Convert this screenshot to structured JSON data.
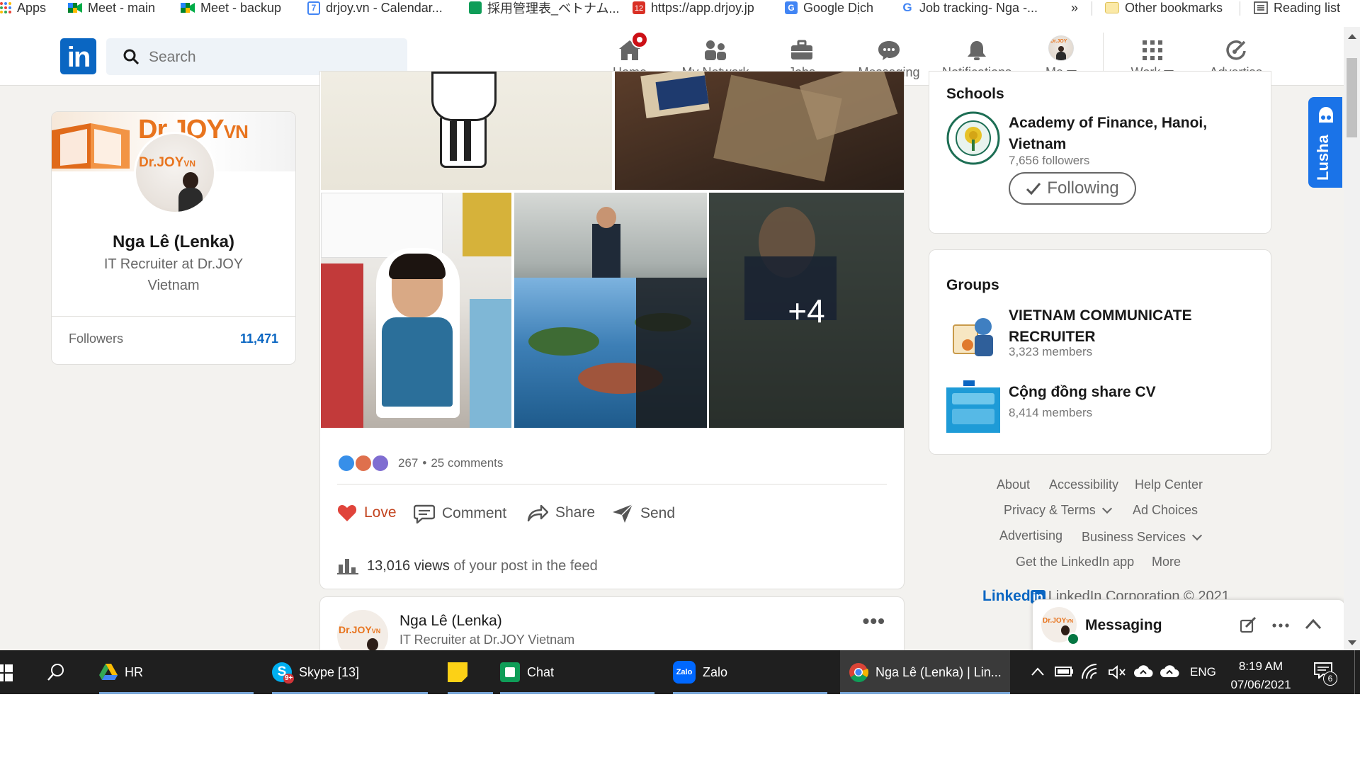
{
  "bookmarks": [
    {
      "label": "Apps",
      "icon": "apps-grid-icon"
    },
    {
      "label": "Meet - main",
      "icon": "google-meet-icon"
    },
    {
      "label": "Meet - backup",
      "icon": "google-meet-icon"
    },
    {
      "label": "drjoy.vn - Calendar...",
      "icon": "calendar-icon"
    },
    {
      "label": "採用管理表_ベトナム...",
      "icon": "sheets-icon"
    },
    {
      "label": "https://app.drjoy.jp",
      "icon": "calendar-12-icon"
    },
    {
      "label": "Google Dịch",
      "icon": "google-translate-icon"
    },
    {
      "label": "Job tracking- Nga -...",
      "icon": "google-icon"
    },
    {
      "label": "»",
      "icon": "more-icon"
    },
    {
      "label": "Other bookmarks",
      "icon": "folder-icon"
    },
    {
      "label": "Reading list",
      "icon": "reading-list-icon"
    }
  ],
  "nav": {
    "search_placeholder": "Search",
    "items": [
      {
        "label": "Home",
        "icon": "home-icon"
      },
      {
        "label": "My Network",
        "icon": "network-icon"
      },
      {
        "label": "Jobs",
        "icon": "briefcase-icon"
      },
      {
        "label": "Messaging",
        "icon": "messaging-icon"
      },
      {
        "label": "Notifications",
        "icon": "bell-icon"
      },
      {
        "label": "Me",
        "icon": "avatar-icon"
      },
      {
        "label": "Work",
        "icon": "grid-icon"
      },
      {
        "label": "Advertise",
        "icon": "advertise-icon"
      }
    ]
  },
  "profile": {
    "banner_logo": "Dr.JOY",
    "banner_logo_suffix": "VN",
    "name": "Nga Lê (Lenka)",
    "headline": "IT Recruiter at Dr.JOY Vietnam",
    "followers_label": "Followers",
    "followers_count": "11,471"
  },
  "post": {
    "more_photos": "+4",
    "reaction_count": "267",
    "comments": "25 comments",
    "actions": {
      "love": "Love",
      "comment": "Comment",
      "share": "Share",
      "send": "Send"
    },
    "views_count": "13,016 views",
    "views_suffix": "of your post in the feed"
  },
  "post2": {
    "name": "Nga Lê (Lenka)",
    "headline": "IT Recruiter at Dr.JOY Vietnam",
    "more": "•••"
  },
  "schools": {
    "title": "Schools",
    "name": "Academy of Finance, Hanoi, Vietnam",
    "followers": "7,656 followers",
    "button": "Following"
  },
  "groups": {
    "title": "Groups",
    "items": [
      {
        "name": "VIETNAM COMMUNICATE RECRUITER",
        "members": "3,323 members"
      },
      {
        "name": "Cộng đồng share CV",
        "members": "8,414 members"
      }
    ]
  },
  "footer": {
    "about": "About",
    "accessibility": "Accessibility",
    "help": "Help Center",
    "privacy": "Privacy & Terms",
    "adchoices": "Ad Choices",
    "advertising": "Advertising",
    "business": "Business Services",
    "getapp": "Get the LinkedIn app",
    "more": "More",
    "brand_word": "Linked",
    "brand_box": "in",
    "copyright": "LinkedIn Corporation © 2021"
  },
  "lusha": {
    "label": "Lusha"
  },
  "messaging": {
    "title": "Messaging"
  },
  "taskbar": {
    "apps": [
      {
        "label": "HR",
        "icon": "google-drive-icon"
      },
      {
        "label": "Skype [13]",
        "icon": "skype-icon"
      },
      {
        "label": "",
        "icon": "sticky-notes-icon"
      },
      {
        "label": "Chat",
        "icon": "hangouts-chat-icon"
      },
      {
        "label": "Zalo",
        "icon": "zalo-icon"
      },
      {
        "label": "Nga Lê (Lenka) | Lin...",
        "icon": "chrome-icon"
      }
    ],
    "skype_badge": "9+",
    "zalo_icon_text": "Zalo",
    "language": "ENG",
    "time": "8:19 AM",
    "date": "07/06/2021",
    "notifications": "6"
  },
  "colors": {
    "linkedin_blue": "#0a66c2",
    "background": "#f3f2ef",
    "love_red": "#e0443b",
    "lusha_blue": "#1a73e8",
    "taskbar": "#1f1f1f"
  }
}
